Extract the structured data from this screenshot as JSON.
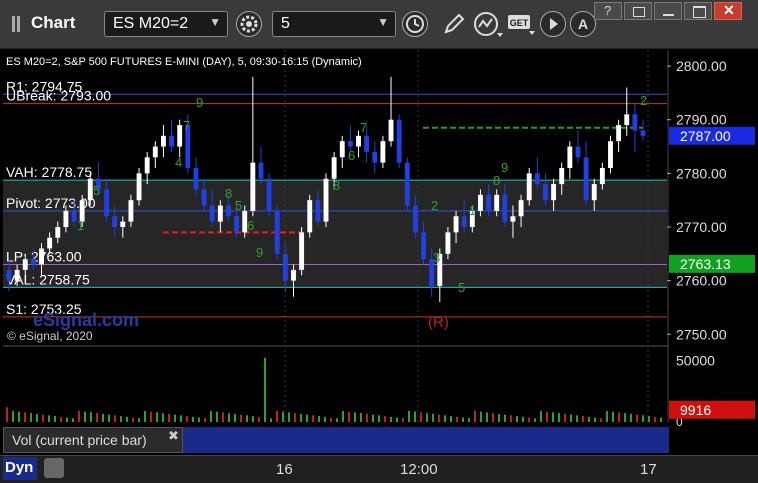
{
  "window": {
    "title": "Chart",
    "symbol": "ES M20=2",
    "interval": "5"
  },
  "chart_info": {
    "header": "ES M20=2, S&P 500 FUTURES E-MINI (DAY), 5, 09:30-16:15 (Dynamic)",
    "copyright": "© eSignal, 2020",
    "watermark": "eSignal.com"
  },
  "levels": [
    {
      "label": "R1: 2794.75",
      "value": 2794.75,
      "color": "#3050e0"
    },
    {
      "label": "UBreak: 2793.00",
      "value": 2793.0,
      "color": "#d03030"
    },
    {
      "label": "VAH: 2778.75",
      "value": 2778.75,
      "color": "#20c0c0"
    },
    {
      "label": "Pivot: 2773.00",
      "value": 2773.0,
      "color": "#3050e0"
    },
    {
      "label": "LP: 2763.00",
      "value": 2763.0,
      "color": "#a060c0"
    },
    {
      "label": "VAL: 2758.75",
      "value": 2758.75,
      "color": "#20c0c0"
    },
    {
      "label": "S1: 2753.25",
      "value": 2753.25,
      "color": "#d03030"
    }
  ],
  "price_axis": {
    "ticks": [
      "2800.00",
      "2790.00",
      "2780.00",
      "2770.00",
      "2760.00",
      "2750.00"
    ],
    "last_price": "2787.00",
    "last_price_value": 2787.0,
    "lp_tag": "2763.13",
    "lp_tag_value": 2763.13
  },
  "volume_axis": {
    "ticks": [
      "50000",
      "0"
    ],
    "current": "9916"
  },
  "volume_panel": {
    "label": "Vol (current price bar)"
  },
  "time_axis": {
    "labels": [
      "16",
      "12:00",
      "17"
    ]
  },
  "footer": {
    "mode": "Dyn"
  },
  "markers": {
    "r_label": "(R)"
  },
  "chart_data": {
    "type": "candlestick",
    "y_range": [
      2748,
      2803
    ],
    "last_price": 2787.0,
    "volume_last": 9916
  }
}
